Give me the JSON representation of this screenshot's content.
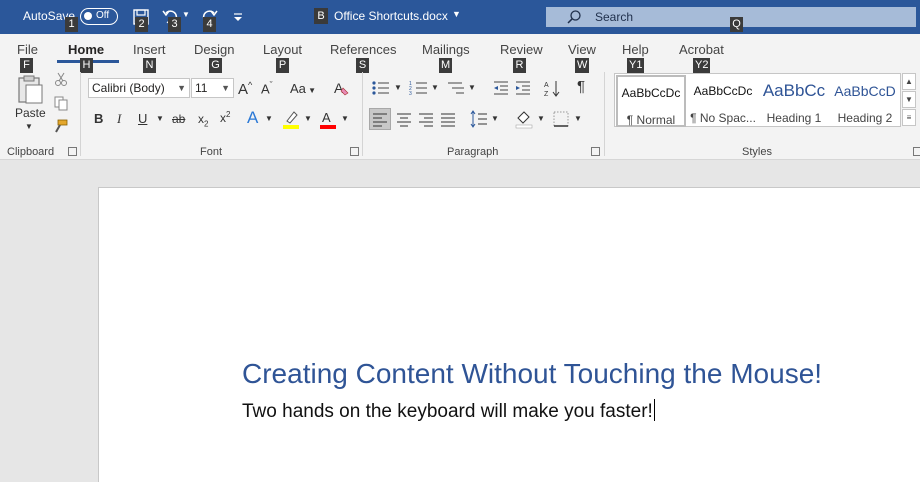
{
  "titlebar": {
    "autosave_label": "AutoSave",
    "autosave_state": "Off",
    "doc_badge": "B",
    "doc_title": "Office Shortcuts.docx",
    "search_placeholder": "Search",
    "search_keytip": "Q",
    "qat_keytips": [
      "1",
      "2",
      "3",
      "4"
    ]
  },
  "tabs": [
    {
      "label": "File",
      "keytip": "F"
    },
    {
      "label": "Home",
      "keytip": "H",
      "active": true
    },
    {
      "label": "Insert",
      "keytip": "N"
    },
    {
      "label": "Design",
      "keytip": "G"
    },
    {
      "label": "Layout",
      "keytip": "P"
    },
    {
      "label": "References",
      "keytip": "S"
    },
    {
      "label": "Mailings",
      "keytip": "M"
    },
    {
      "label": "Review",
      "keytip": "R"
    },
    {
      "label": "View",
      "keytip": "W"
    },
    {
      "label": "Help",
      "keytip": "Y1"
    },
    {
      "label": "Acrobat",
      "keytip": "Y2"
    }
  ],
  "clipboard": {
    "paste_label": "Paste",
    "group_label": "Clipboard"
  },
  "font": {
    "name": "Calibri (Body)",
    "size": "11",
    "change_case": "Aa",
    "group_label": "Font"
  },
  "paragraph": {
    "group_label": "Paragraph"
  },
  "styles": {
    "group_label": "Styles",
    "items": [
      {
        "preview": "AaBbCcDc",
        "name": "¶ Normal"
      },
      {
        "preview": "AaBbCcDc",
        "name": "¶ No Spac..."
      },
      {
        "preview": "AaBbCc",
        "name": "Heading 1"
      },
      {
        "preview": "AaBbCcD",
        "name": "Heading 2"
      }
    ]
  },
  "document": {
    "heading": "Creating Content Without Touching the Mouse!",
    "body": "Two hands on the keyboard will make you faster!"
  },
  "colors": {
    "accent": "#2b579a",
    "heading": "#2f5496",
    "highlight": "#ffff00",
    "font_color": "#ff0000"
  }
}
